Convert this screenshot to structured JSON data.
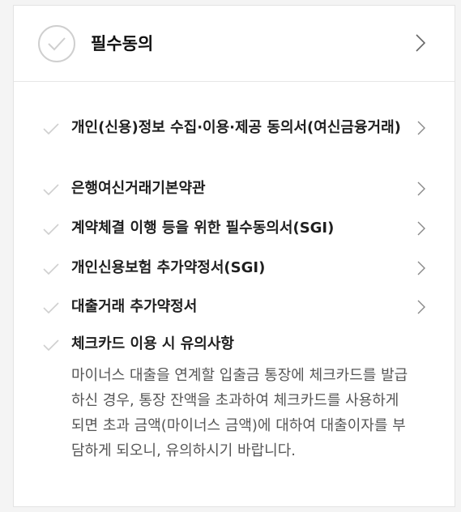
{
  "header": {
    "title": "필수동의"
  },
  "items": [
    {
      "label": "개인(신용)정보 수집·이용·제공 동의서(여신금융거래)",
      "has_chevron": true
    },
    {
      "label": "은행여신거래기본약관",
      "has_chevron": true
    },
    {
      "label": "계약체결 이행 등을 위한 필수동의서(SGI)",
      "has_chevron": true
    },
    {
      "label": "개인신용보험 추가약정서(SGI)",
      "has_chevron": true
    },
    {
      "label": "대출거래 추가약정서",
      "has_chevron": true
    },
    {
      "label": "체크카드 이용 시 유의사항",
      "has_chevron": false
    }
  ],
  "notice": {
    "text": "마이너스 대출을 연계할 입출금 통장에 체크카드를 발급하신 경우, 통장 잔액을 초과하여 체크카드를 사용하게 되면 초과 금액(마이너스 금액)에 대하여 대출이자를 부담하게 되오니, 유의하시기 바랍니다."
  },
  "colors": {
    "check": "#cfcfcf",
    "chevron": "#888888",
    "title": "#111111",
    "description": "#555555"
  },
  "icons": {
    "header_check": "check-circle-icon",
    "item_check": "check-icon",
    "chevron": "chevron-right-icon"
  }
}
